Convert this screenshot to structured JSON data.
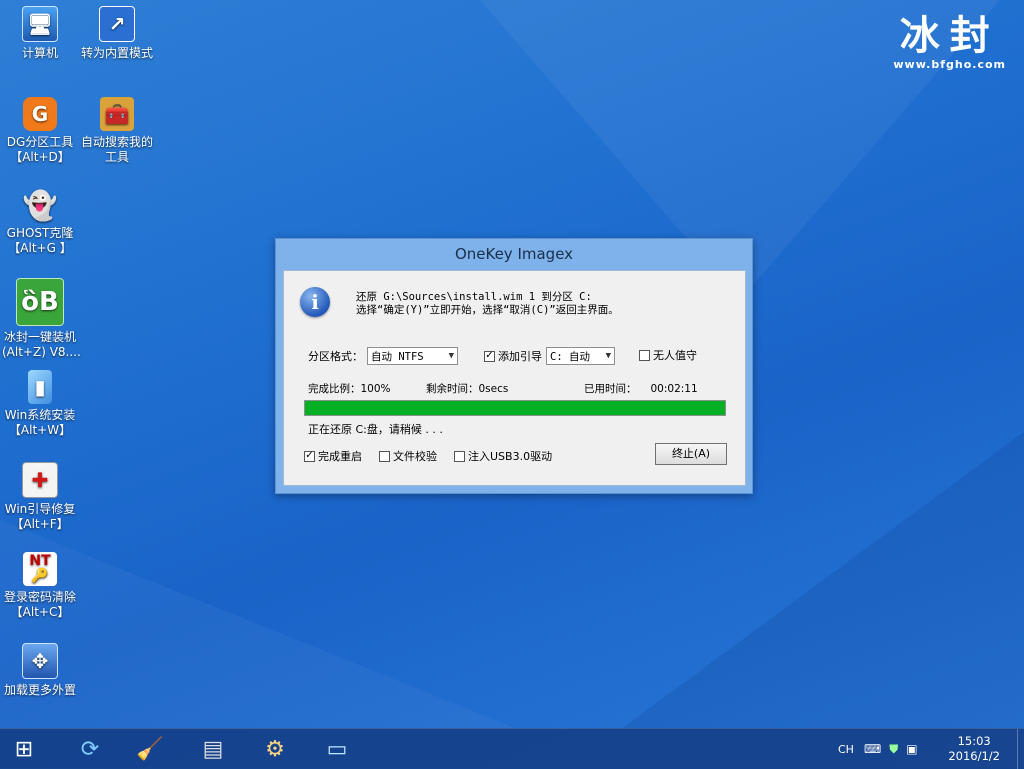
{
  "desktop": {
    "icons": [
      {
        "line1": "计算机",
        "line2": "",
        "glyph": "monitor-icon"
      },
      {
        "line1": "转为内置模式",
        "line2": "",
        "glyph": "shortcut-icon"
      },
      {
        "line1": "DG分区工具",
        "line2": "【Alt+D】",
        "glyph": "diskgenius-icon"
      },
      {
        "line1": "自动搜索我的",
        "line2": "工具",
        "glyph": "toolbox-icon"
      },
      {
        "line1": "GHOST克隆",
        "line2": "【Alt+G 】",
        "glyph": "ghost-icon"
      },
      {
        "line1": "冰封一键装机",
        "line2": "(Alt+Z) V8....",
        "glyph": "ghost-green-icon"
      },
      {
        "line1": "Win系统安装",
        "line2": "【Alt+W】",
        "glyph": "windows-setup-icon"
      },
      {
        "line1": "Win引导修复",
        "line2": "【Alt+F】",
        "glyph": "repair-kit-icon"
      },
      {
        "line1": "登录密码清除",
        "line2": "【Alt+C】",
        "glyph": "key-icon"
      },
      {
        "line1": "加载更多外置",
        "line2": "",
        "glyph": "load-more-icon"
      }
    ]
  },
  "brand": {
    "title": "冰封",
    "url": "www.bfgho.com"
  },
  "dialog": {
    "title": "OneKey Imagex",
    "message_line1": "还原 G:\\Sources\\install.wim 1 到分区 C:",
    "message_line2": "选择“确定(Y)”立即开始，选择“取消(C)”返回主界面。",
    "partition_format_label": "分区格式：",
    "partition_format_value": "自动 NTFS",
    "add_boot_label": "添加引导",
    "add_boot_checked": true,
    "boot_target_value": "C: 自动",
    "unattended_label": "无人值守",
    "unattended_checked": false,
    "progress_label": "完成比例：100%",
    "remaining_label": "剩余时间：0secs",
    "elapsed_label": "已用时间：",
    "elapsed_value": "00:02:11",
    "progress_percent": 100,
    "status_text": "正在还原 C:盘，请稍候 . . .",
    "reboot_label": "完成重启",
    "reboot_checked": true,
    "verify_label": "文件校验",
    "verify_checked": false,
    "usb3_label": "注入USB3.0驱动",
    "usb3_checked": false,
    "abort_button": "终止(A)"
  },
  "taskbar": {
    "items": [
      "start-icon",
      "refresh-icon",
      "cleanup-brush-icon",
      "memory-chip-icon",
      "settings-gear-icon",
      "notepad-icon"
    ],
    "tray_lang": "CH",
    "time": "15:03",
    "date": "2016/1/2"
  },
  "colors": {
    "progress_fill": "#06b025",
    "dialog_frame": "#7fb2ea",
    "taskbar": "#143c82"
  }
}
